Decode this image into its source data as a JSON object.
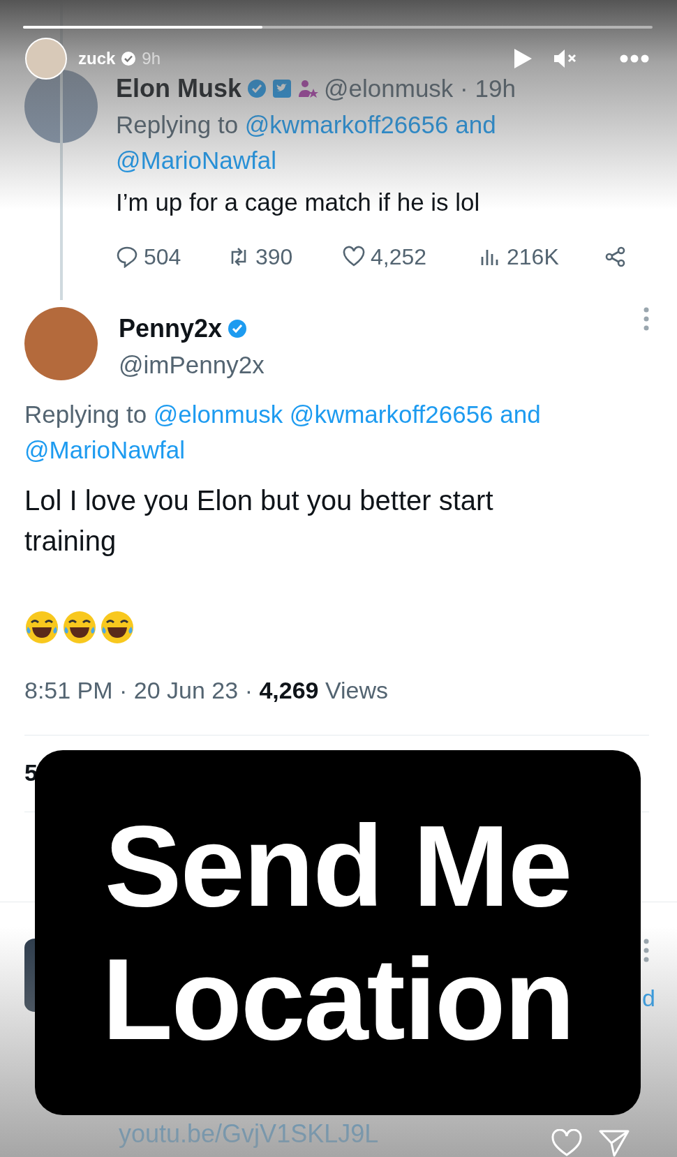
{
  "story": {
    "progress": {
      "level": 0.38
    },
    "user": "zuck",
    "time": "9h"
  },
  "parent_tweet": {
    "name": "Elon Musk",
    "handle_time": "@elonmusk · 19h",
    "reply_prefix": "Replying to",
    "reply_to": "@kwmarkoff26656 and @MarioNawfal",
    "text": "I’m up for a cage match if he is lol",
    "actions": [
      {
        "kind": "reply",
        "count": "504"
      },
      {
        "kind": "retweet",
        "count": "390"
      },
      {
        "kind": "like",
        "count": "4,252"
      },
      {
        "kind": "views",
        "count": "216K"
      },
      {
        "kind": "share"
      }
    ]
  },
  "main_tweet": {
    "name": "Penny2x",
    "handle": "@imPenny2x",
    "reply_prefix": "Replying to",
    "reply_to": "@elonmusk @kwmarkoff26656 and @MarioNawfal",
    "text": "Lol I love you Elon but you better start training",
    "emojis": [
      {
        "kind": "laughing"
      },
      {
        "kind": "laughing"
      },
      {
        "kind": "laughing"
      }
    ],
    "meta": "8:51 PM · 20 Jun 23 · **4,269** Views",
    "stat_fragment": "5"
  },
  "next_tweet": {
    "text_fragment": "d",
    "link": "youtu.be/GvjV1SKLJ9L"
  },
  "sticker": {
    "lines": [
      "Send Me",
      "Location"
    ]
  }
}
